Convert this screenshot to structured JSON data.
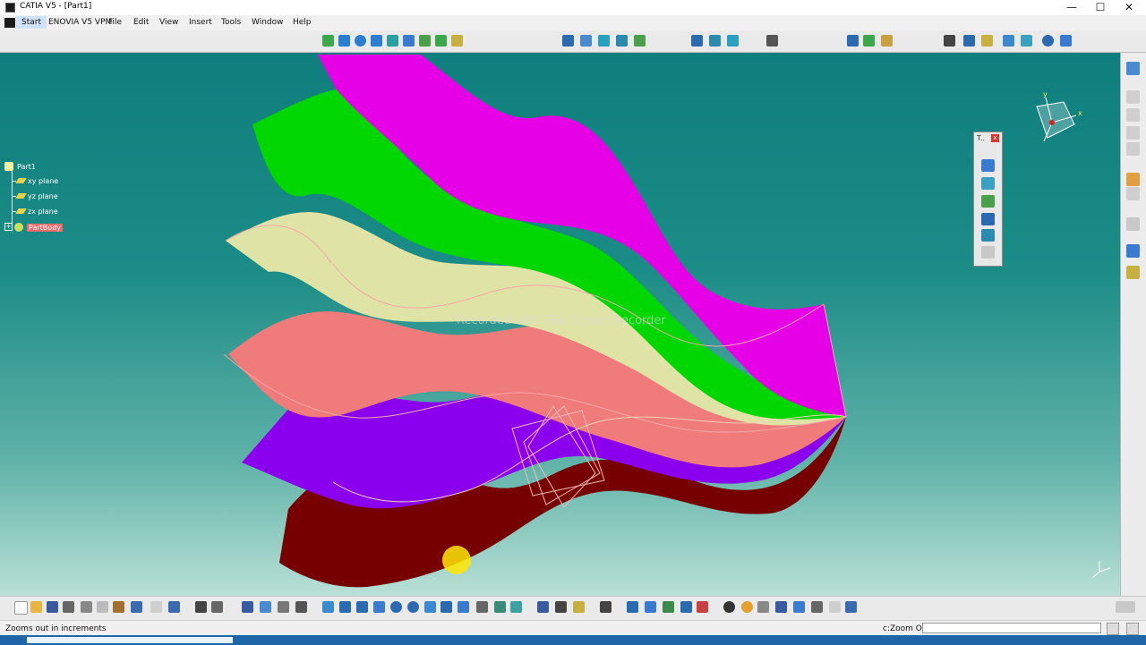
{
  "window": {
    "title": "CATIA V5 - [Part1]",
    "minimize": "—",
    "maximize": "☐",
    "close": "✕"
  },
  "menu": {
    "items": [
      "Start",
      "ENOVIA V5 VPM",
      "File",
      "Edit",
      "View",
      "Insert",
      "Tools",
      "Window",
      "Help"
    ]
  },
  "tree": {
    "root": "Part1",
    "items": [
      "xy plane",
      "yz plane",
      "zx plane",
      "PartBody"
    ]
  },
  "floating_toolbar": {
    "title": "T..",
    "close": "x"
  },
  "compass": {
    "x_label": "x",
    "y_label": "y"
  },
  "watermark": "Recorded with iTop Screen Recorder",
  "status": {
    "message": "Zooms out in increments",
    "command_label": "c:Zoom Out",
    "command_value": ""
  },
  "colors": {
    "viewport_top": "#0f7e7e",
    "viewport_bottom": "#b9e0d6",
    "surface_magenta": "#e600e6",
    "surface_green": "#00d600",
    "surface_cream": "#dfe3a5",
    "surface_salmon": "#ef7b7b",
    "surface_violet": "#8a00ee",
    "surface_maroon": "#760000",
    "selection": "#ef6b6b"
  }
}
